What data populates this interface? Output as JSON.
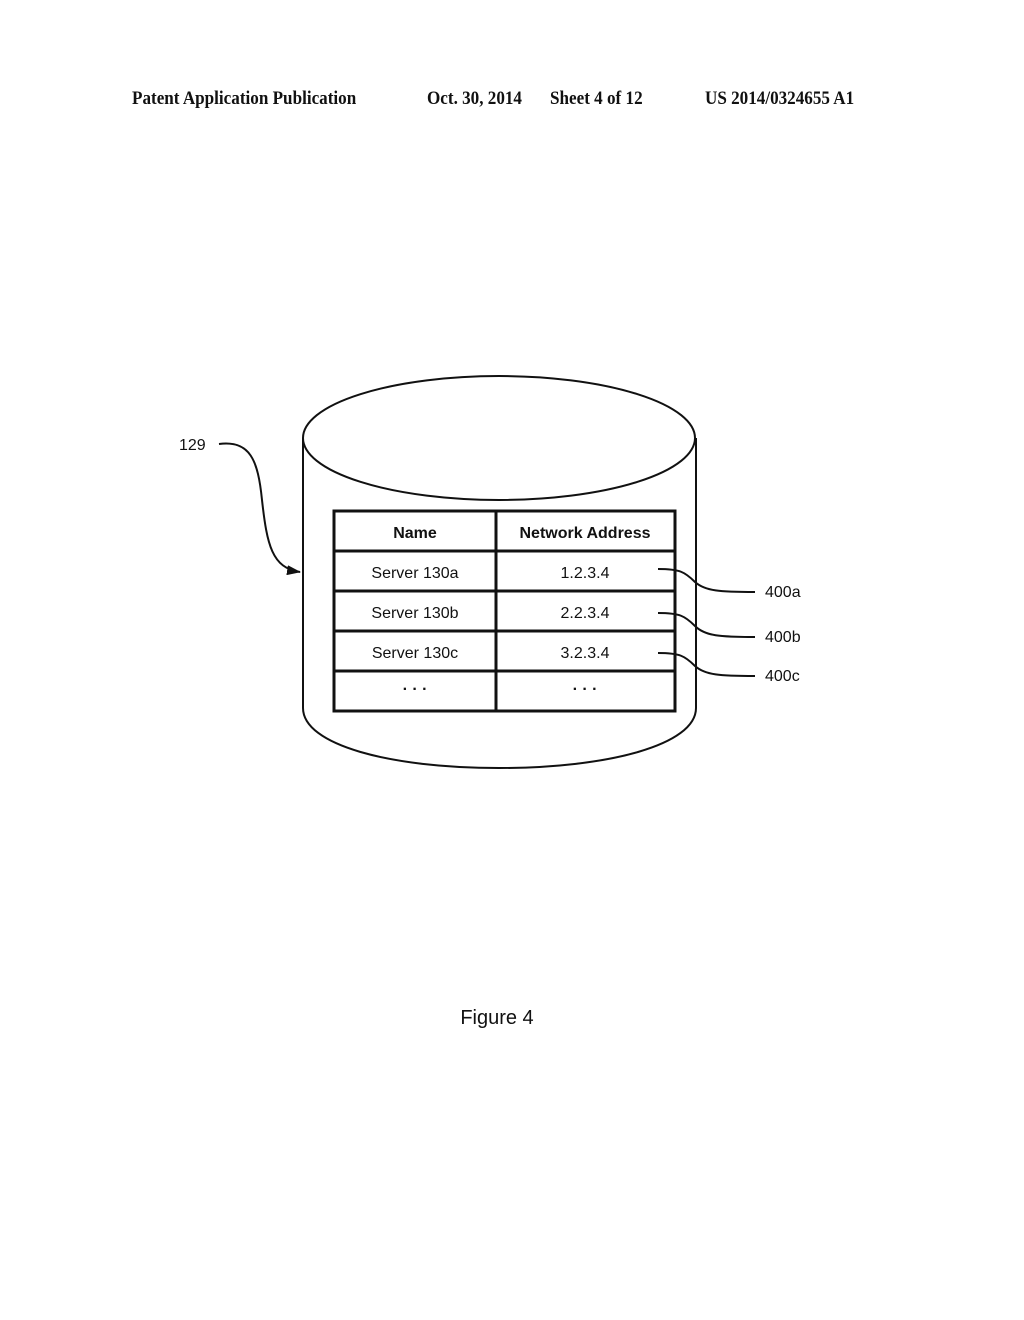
{
  "header": {
    "publication": "Patent Application Publication",
    "date": "Oct. 30, 2014",
    "sheet": "Sheet 4 of 12",
    "number": "US 2014/0324655 A1"
  },
  "figure": {
    "database_ref": "129",
    "caption": "Figure 4",
    "table": {
      "columns": [
        "Name",
        "Network Address"
      ],
      "rows": [
        {
          "name": "Server 130a",
          "address": "1.2.3.4",
          "ref": "400a"
        },
        {
          "name": "Server 130b",
          "address": "2.2.3.4",
          "ref": "400b"
        },
        {
          "name": "Server 130c",
          "address": "3.2.3.4",
          "ref": "400c"
        },
        {
          "name": "· · ·",
          "address": "· · ·",
          "ref": ""
        }
      ]
    }
  }
}
